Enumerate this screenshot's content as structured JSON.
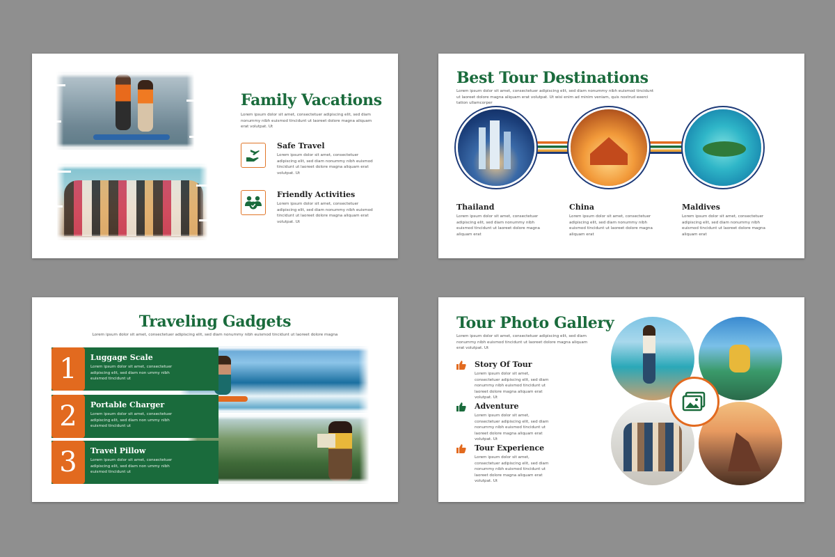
{
  "slide1": {
    "title": "Family Vacations",
    "intro": "Lorem ipsum dolor sit amet, consectetuer adipiscing elit, sed diam nonummy nibh euismod tincidunt ut laoreet dolore magna aliquam erat volutpat. Ut",
    "items": [
      {
        "title": "Safe Travel",
        "text": "Lorem ipsum dolor sit amet, consectetuer adipiscing elit, sed diam nonummy nibh euismod tincidunt ut laoreet dolore magna aliquam erat volutpat. Ut",
        "icon": "hand-airplane-icon"
      },
      {
        "title": "Friendly Activities",
        "text": "Lorem ipsum dolor sit amet, consectetuer adipiscing elit, sed diam nonummy nibh euismod tincidunt ut laoreet dolore magna aliquam erat volutpat. Ut",
        "icon": "group-check-icon"
      }
    ]
  },
  "slide2": {
    "title": "Best Tour Destinations",
    "intro": "Lorem ipsum dolor sit amet, consectetuer adipiscing elit, sed diam nonummy nibh euismod tincidunt ut laoreet dolore magna aliquam erat volutpat. Ut wisi enim ad minim veniam, quis nostrud exerci tation ullamcorper",
    "destinations": [
      {
        "name": "Thailand",
        "text": "Lorem ipsum dolor sit amet, consectetuer adipiscing elit, sed diam nonummy nibh euismod tincidunt ut laoreet dolore magna aliquam erat"
      },
      {
        "name": "China",
        "text": "Lorem ipsum dolor sit amet, consectetuer adipiscing elit, sed diam nonummy nibh euismod tincidunt ut laoreet dolore magna aliquam erat"
      },
      {
        "name": "Maldives",
        "text": "Lorem ipsum dolor sit amet, consectetuer adipiscing elit, sed diam nonummy nibh euismod tincidunt ut laoreet dolore magna aliquam erat"
      }
    ]
  },
  "slide3": {
    "title": "Traveling Gadgets",
    "intro": "Lorem ipsum dolor sit amet, consectetuer adipiscing elit, sed diam nonummy nibh euismod tincidunt ut laoreet dolore magna",
    "items": [
      {
        "num": "1",
        "title": "Luggage Scale",
        "text": "Lorem ipsum dolor sit amet, consectetuer adipiscing elit, sed diam non ummy nibh euismod tincidunt ut"
      },
      {
        "num": "2",
        "title": "Portable Charger",
        "text": "Lorem ipsum dolor sit amet, consectetuer adipiscing elit, sed diam non ummy nibh euismod tincidunt ut"
      },
      {
        "num": "3",
        "title": "Travel Pillow",
        "text": "Lorem ipsum dolor sit amet, consectetuer adipiscing elit, sed diam non ummy nibh euismod tincidunt ut"
      }
    ]
  },
  "slide4": {
    "title": "Tour Photo Gallery",
    "intro": "Lorem ipsum dolor sit amet, consectetuer adipiscing elit, sed diam nonummy nibh euismod tincidunt ut laoreet dolore magna aliquam erat volutpat. Ut",
    "items": [
      {
        "title": "Story Of Tour",
        "text": "Lorem ipsum dolor sit amet, consectetuer adipiscing elit, sed diam nonummy nibh euismod tincidunt ut laoreet dolore magna aliquam erat volutpat. Ut"
      },
      {
        "title": "Adventure",
        "text": "Lorem ipsum dolor sit amet, consectetuer adipiscing elit, sed diam nonummy nibh euismod tincidunt ut laoreet dolore magna aliquam erat volutpat. Ut"
      },
      {
        "title": "Tour Experience",
        "text": "Lorem ipsum dolor sit amet, consectetuer adipiscing elit, sed diam nonummy nibh euismod tincidunt ut laoreet dolore magna aliquam erat volutpat. Ut"
      }
    ],
    "thumb_colors": [
      "#e26a1f",
      "#1a6b3c",
      "#e26a1f"
    ]
  },
  "colors": {
    "green": "#1a6b3c",
    "orange": "#e26a1f",
    "background": "#8f8f8f"
  }
}
